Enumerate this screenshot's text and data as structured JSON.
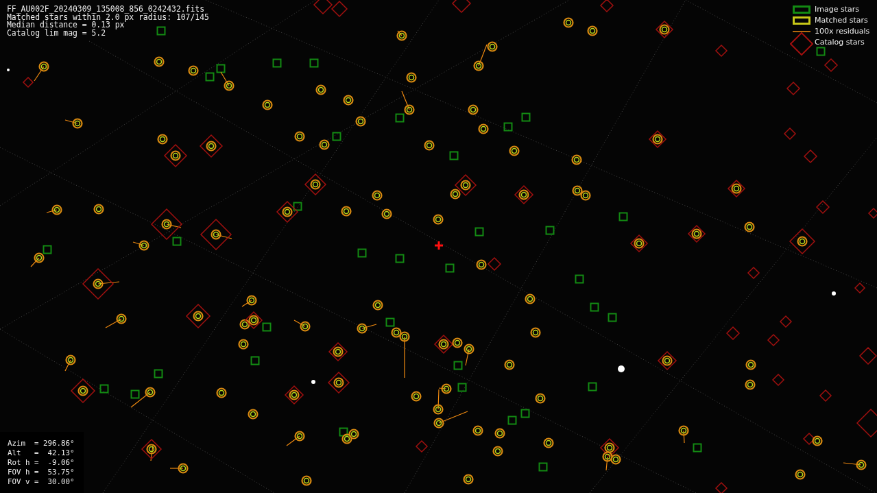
{
  "file_info": [
    "FF_AU002F_20240309_135008_856_0242432.fits",
    "Matched stars within 2.0 px radius: 107/145",
    "Median distance = 0.13 px",
    "Catalog lim mag = 5.2"
  ],
  "legend": [
    {
      "kind": "image",
      "label": "Image stars"
    },
    {
      "kind": "matched",
      "label": "Matched stars"
    },
    {
      "kind": "residual",
      "label": "100x residuals"
    },
    {
      "kind": "catalog",
      "label": "Catalog stars"
    }
  ],
  "pointing": [
    "Azim  = 296.86°",
    "Alt   =  42.13°",
    "Rot h =  -9.06°",
    "FOV h =  53.75°",
    "FOV v =  30.00°"
  ]
}
